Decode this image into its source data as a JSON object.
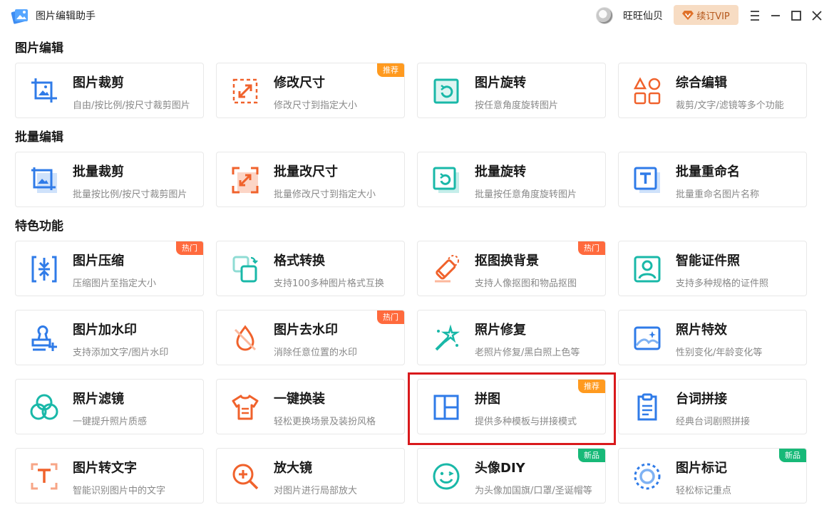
{
  "app": {
    "title": "图片编辑助手",
    "username": "旺旺仙贝",
    "vip_label": "续订VIP"
  },
  "colors": {
    "blue": "#2f7be8",
    "orange": "#f0622c",
    "teal": "#19b8a8",
    "badge_orange": "#ff9a1f",
    "badge_hot": "#ff6a3d",
    "badge_green": "#17b978",
    "highlight": "#d9191c"
  },
  "sections": {
    "edit": "图片编辑",
    "batch": "批量编辑",
    "features": "特色功能"
  },
  "cards": {
    "crop": {
      "title": "图片裁剪",
      "desc": "自由/按比例/按尺寸裁剪图片",
      "icon": "crop-icon"
    },
    "resize": {
      "title": "修改尺寸",
      "desc": "修改尺寸到指定大小",
      "badge": "推荐",
      "icon": "resize-icon"
    },
    "rotate": {
      "title": "图片旋转",
      "desc": "按任意角度旋转图片",
      "icon": "rotate-icon"
    },
    "compose": {
      "title": "综合编辑",
      "desc": "裁剪/文字/滤镜等多个功能",
      "icon": "shapes-icon"
    },
    "batch_crop": {
      "title": "批量裁剪",
      "desc": "批量按比例/按尺寸裁剪图片",
      "icon": "batch-crop-icon"
    },
    "batch_resize": {
      "title": "批量改尺寸",
      "desc": "批量修改尺寸到指定大小",
      "icon": "batch-resize-icon"
    },
    "batch_rotate": {
      "title": "批量旋转",
      "desc": "批量按任意角度旋转图片",
      "icon": "batch-rotate-icon"
    },
    "batch_rename": {
      "title": "批量重命名",
      "desc": "批量重命名图片名称",
      "icon": "rename-icon"
    },
    "compress": {
      "title": "图片压缩",
      "desc": "压缩图片至指定大小",
      "badge": "热门",
      "icon": "compress-icon"
    },
    "convert": {
      "title": "格式转换",
      "desc": "支持100多种图片格式互换",
      "icon": "convert-icon"
    },
    "cutout": {
      "title": "抠图换背景",
      "desc": "支持人像抠图和物品抠图",
      "badge": "热门",
      "icon": "eraser-icon"
    },
    "idphoto": {
      "title": "智能证件照",
      "desc": "支持多种规格的证件照",
      "icon": "portrait-icon"
    },
    "watermark_add": {
      "title": "图片加水印",
      "desc": "支持添加文字/图片水印",
      "icon": "stamp-icon"
    },
    "watermark_remove": {
      "title": "图片去水印",
      "desc": "消除任意位置的水印",
      "badge": "热门",
      "icon": "drop-slash-icon"
    },
    "repair": {
      "title": "照片修复",
      "desc": "老照片修复/黑白照上色等",
      "icon": "magic-wand-icon"
    },
    "effects": {
      "title": "照片特效",
      "desc": "性别变化/年龄变化等",
      "icon": "landscape-icon"
    },
    "filter": {
      "title": "照片滤镜",
      "desc": "一键提升照片质感",
      "icon": "filter-icon"
    },
    "outfit": {
      "title": "一键换装",
      "desc": "轻松更换场景及装扮风格",
      "icon": "tshirt-icon"
    },
    "collage": {
      "title": "拼图",
      "desc": "提供多种模板与拼接模式",
      "badge": "推荐",
      "icon": "collage-icon"
    },
    "lines": {
      "title": "台词拼接",
      "desc": "经典台词剧照拼接",
      "icon": "clipboard-icon"
    },
    "ocr": {
      "title": "图片转文字",
      "desc": "智能识别图片中的文字",
      "icon": "text-scan-icon"
    },
    "magnifier": {
      "title": "放大镜",
      "desc": "对图片进行局部放大",
      "icon": "zoom-in-icon"
    },
    "avatar_diy": {
      "title": "头像DIY",
      "desc": "为头像加国旗/口罩/圣诞帽等",
      "badge": "新品",
      "icon": "smiley-icon"
    },
    "mark": {
      "title": "图片标记",
      "desc": "轻松标记重点",
      "badge": "新品",
      "icon": "target-icon"
    }
  }
}
